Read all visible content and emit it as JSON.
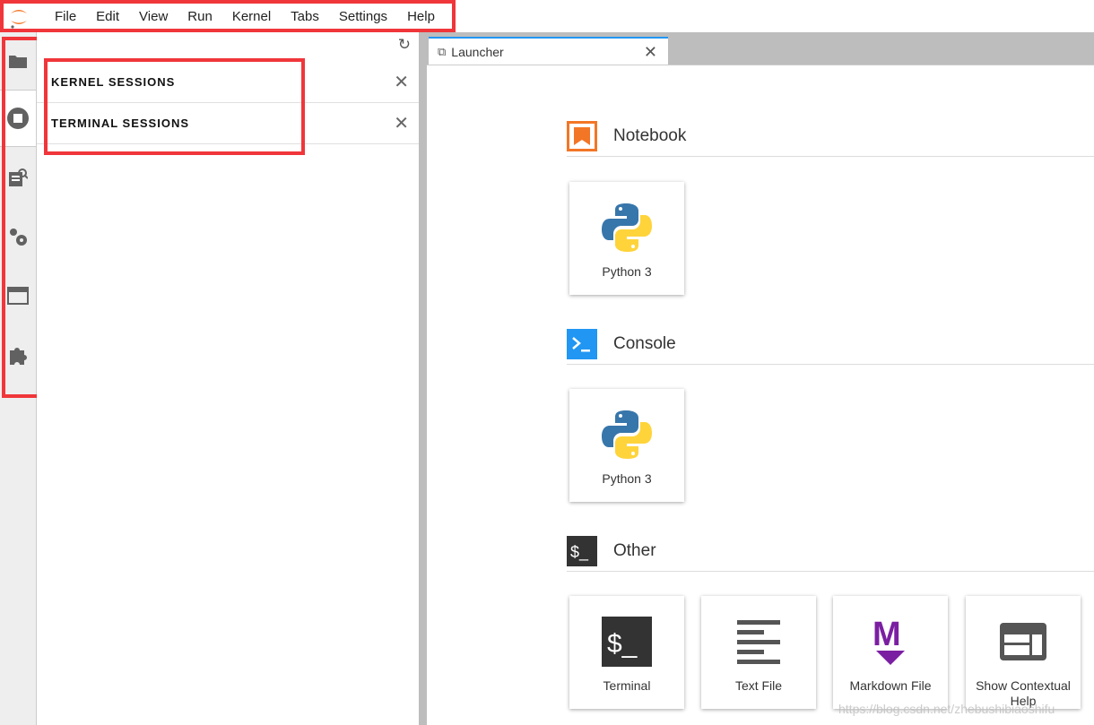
{
  "menubar": {
    "items": [
      "File",
      "Edit",
      "View",
      "Run",
      "Kernel",
      "Tabs",
      "Settings",
      "Help"
    ]
  },
  "sidebar": {
    "sections": [
      {
        "label": "KERNEL SESSIONS"
      },
      {
        "label": "TERMINAL SESSIONS"
      }
    ]
  },
  "tab": {
    "label": "Launcher"
  },
  "launcher": {
    "notebook": {
      "title": "Notebook",
      "cards": [
        "Python 3"
      ]
    },
    "console": {
      "title": "Console",
      "cards": [
        "Python 3"
      ]
    },
    "other": {
      "title": "Other",
      "cards": [
        "Terminal",
        "Text File",
        "Markdown File",
        "Show Contextual Help"
      ]
    }
  },
  "watermark": "https://blog.csdn.net/zhebushibiaoshifu",
  "colors": {
    "accent": "#2196f3",
    "highlight": "#f0363a",
    "notebook": "#f37626",
    "markdown": "#7b1fa2"
  }
}
